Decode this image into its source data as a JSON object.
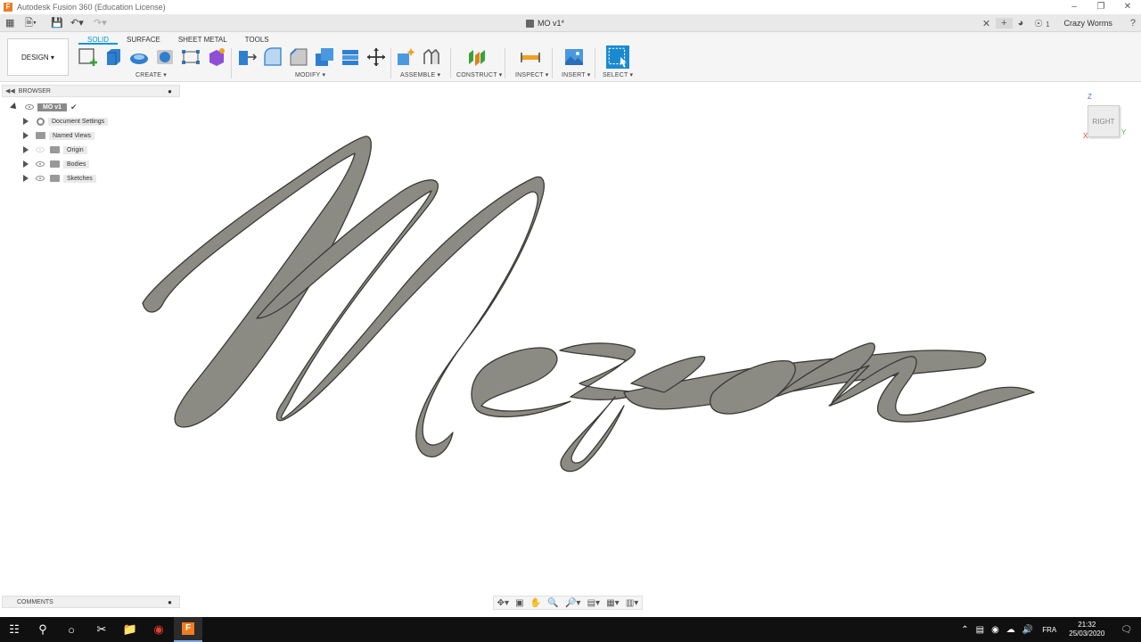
{
  "app": {
    "window_title": "Autodesk Fusion 360 (Education License)",
    "logo_letter": "F"
  },
  "document_tab": {
    "title": "MO v1*"
  },
  "header_right": {
    "job_count": "1",
    "user": "Crazy Worms"
  },
  "workspace": {
    "design_label": "DESIGN",
    "tabs": [
      {
        "label": "SOLID",
        "active": true
      },
      {
        "label": "SURFACE",
        "active": false
      },
      {
        "label": "SHEET METAL",
        "active": false
      },
      {
        "label": "TOOLS",
        "active": false
      }
    ]
  },
  "toolbar_groups": {
    "create": "CREATE",
    "modify": "MODIFY",
    "assemble": "ASSEMBLE",
    "construct": "CONSTRUCT",
    "inspect": "INSPECT",
    "insert": "INSERT",
    "select": "SELECT"
  },
  "browser": {
    "title": "BROWSER",
    "root": "MO v1",
    "items": [
      {
        "label": "Document Settings",
        "icon": "gear-icon"
      },
      {
        "label": "Named Views",
        "icon": "folder-icon"
      },
      {
        "label": "Origin",
        "icon": "folder-icon"
      },
      {
        "label": "Bodies",
        "icon": "folder-icon"
      },
      {
        "label": "Sketches",
        "icon": "folder-icon"
      }
    ]
  },
  "viewcube": {
    "face": "RIGHT",
    "z": "Z",
    "y": "Y",
    "x": "X"
  },
  "comments": {
    "title": "COMMENTS"
  },
  "taskbar": {
    "language": "FRA",
    "time": "21:32",
    "date": "25/03/2020"
  },
  "colors": {
    "accent": "#0696d7",
    "model_fill": "#8c8b83",
    "model_stroke": "#3a3a36",
    "logo": "#f07c20"
  }
}
